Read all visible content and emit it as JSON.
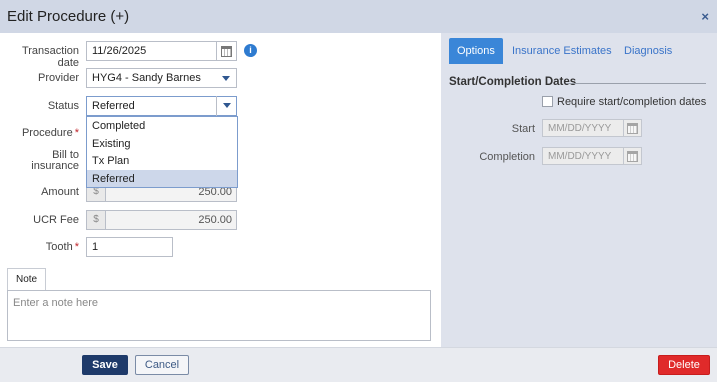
{
  "window": {
    "title": "Edit Procedure (+)",
    "close_symbol": "×"
  },
  "form": {
    "transaction_date": {
      "label": "Transaction date",
      "value": "11/26/2025"
    },
    "provider": {
      "label": "Provider",
      "value": "HYG4 - Sandy Barnes"
    },
    "status": {
      "label": "Status",
      "value": "Referred",
      "options": [
        "Completed",
        "Existing",
        "Tx Plan",
        "Referred"
      ],
      "highlighted": "Referred"
    },
    "procedure": {
      "label": "Procedure",
      "required_mark": "*"
    },
    "bill_to_insurance": {
      "label_line1": "Bill to",
      "label_line2": "insurance"
    },
    "amount": {
      "label": "Amount",
      "prefix": "$",
      "value": "250.00"
    },
    "ucr_fee": {
      "label": "UCR Fee",
      "prefix": "$",
      "value": "250.00"
    },
    "tooth": {
      "label": "Tooth",
      "required_mark": "*",
      "value": "1"
    }
  },
  "note": {
    "tab_label": "Note",
    "placeholder": "Enter a note here"
  },
  "right_panel": {
    "tabs": [
      "Options",
      "Insurance Estimates",
      "Diagnosis"
    ],
    "active_tab": "Options",
    "section_title": "Start/Completion Dates",
    "require_dates_label": "Require start/completion dates",
    "start": {
      "label": "Start",
      "placeholder": "MM/DD/YYYY"
    },
    "completion": {
      "label": "Completion",
      "placeholder": "MM/DD/YYYY"
    }
  },
  "footer": {
    "save_label": "Save",
    "cancel_label": "Cancel",
    "delete_label": "Delete"
  },
  "colors": {
    "primary": "#1e3a6a",
    "accent": "#3a86d8",
    "danger": "#e02a2a",
    "required": "#c0272d"
  },
  "icons": [
    "calendar-icon",
    "info-icon",
    "close-icon",
    "chevron-down-icon"
  ]
}
